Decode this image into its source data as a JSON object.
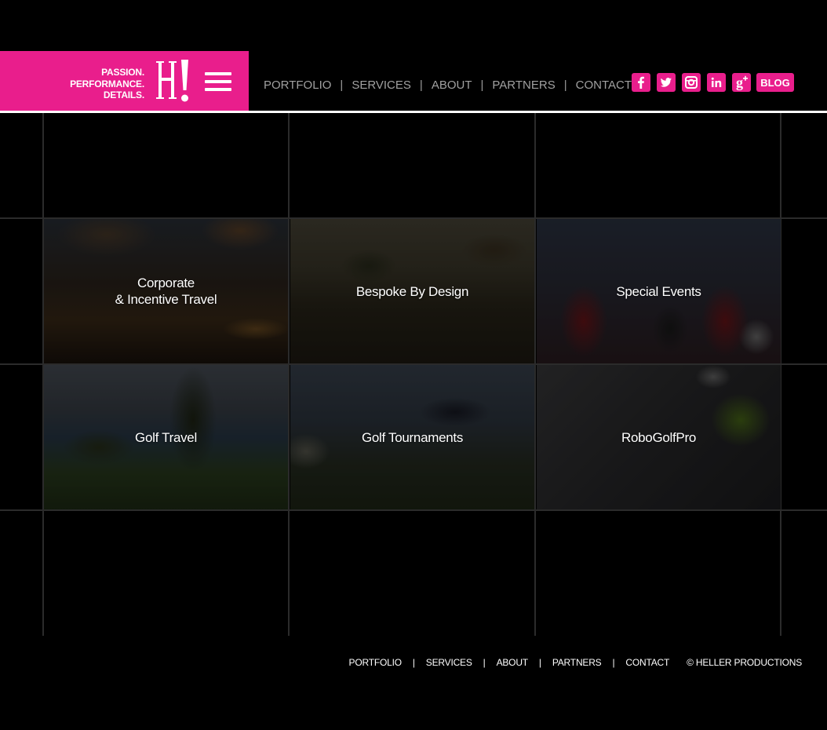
{
  "brand": {
    "tagline": [
      "PASSION.",
      "PERFORMANCE.",
      "DETAILS."
    ],
    "logo_letter": "H!",
    "accent": "#e91e8c"
  },
  "nav": {
    "items": [
      "PORTFOLIO",
      "SERVICES",
      "ABOUT",
      "PARTNERS",
      "CONTACT"
    ],
    "separator": "|"
  },
  "social": {
    "icons": [
      "facebook-icon",
      "twitter-icon",
      "instagram-icon",
      "linkedin-icon",
      "google-plus-icon"
    ],
    "blog_label": "BLOG"
  },
  "tiles": [
    {
      "line1": "Corporate",
      "line2": "& Incentive Travel"
    },
    {
      "line1": "Bespoke By Design",
      "line2": ""
    },
    {
      "line1": "Special Events",
      "line2": ""
    },
    {
      "line1": "Golf Travel",
      "line2": ""
    },
    {
      "line1": "Golf Tournaments",
      "line2": ""
    },
    {
      "line1": "RoboGolfPro",
      "line2": ""
    }
  ],
  "footer": {
    "items": [
      "PORTFOLIO",
      "SERVICES",
      "ABOUT",
      "PARTNERS",
      "CONTACT"
    ],
    "separator": "|",
    "copyright": "© HELLER PRODUCTIONS"
  }
}
